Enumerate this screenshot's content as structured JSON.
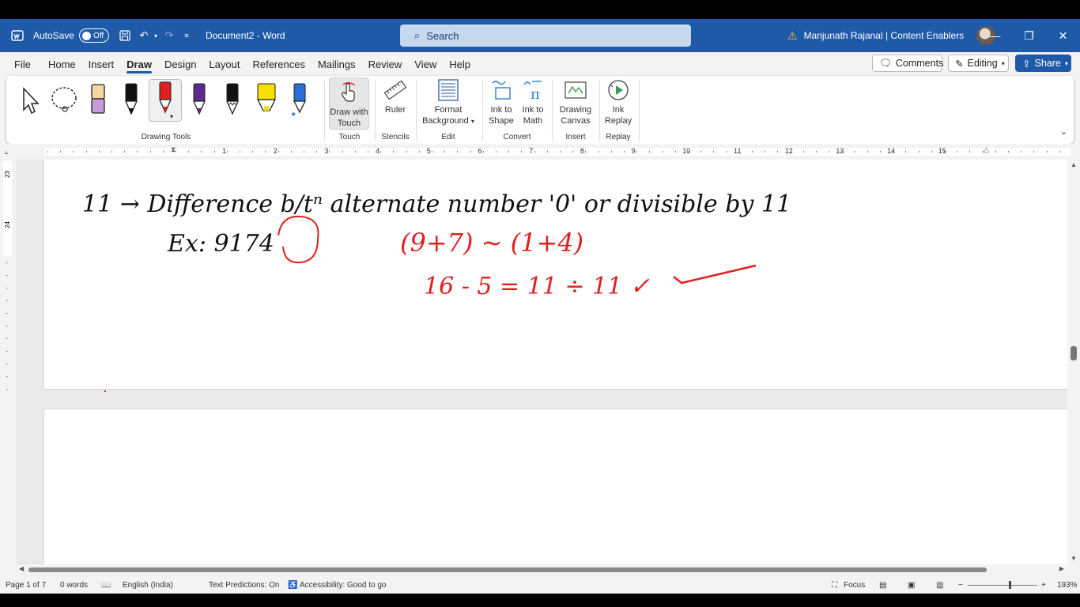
{
  "titlebar": {
    "autosave_label": "AutoSave",
    "autosave_state": "Off",
    "doc_title": "Document2  -  Word",
    "search_placeholder": "Search",
    "user_name": "Manjunath Rajanal | Content Enablers"
  },
  "menu": {
    "tabs": [
      "File",
      "Home",
      "Insert",
      "Draw",
      "Design",
      "Layout",
      "References",
      "Mailings",
      "Review",
      "View",
      "Help"
    ],
    "active": "Draw",
    "comments_label": "Comments",
    "editing_label": "Editing",
    "share_label": "Share"
  },
  "ribbon": {
    "groups": {
      "drawing_tools": "Drawing Tools",
      "touch": "Touch",
      "stencils": "Stencils",
      "edit": "Edit",
      "convert": "Convert",
      "insert": "Insert",
      "replay": "Replay"
    },
    "buttons": {
      "draw_with_touch_1": "Draw with",
      "draw_with_touch_2": "Touch",
      "ruler": "Ruler",
      "format_bg_1": "Format",
      "format_bg_2": "Background",
      "ink_shape_1": "Ink to",
      "ink_shape_2": "Shape",
      "ink_math_1": "Ink to",
      "ink_math_2": "Math",
      "drawing_canvas_1": "Drawing",
      "drawing_canvas_2": "Canvas",
      "ink_replay_1": "Ink",
      "ink_replay_2": "Replay"
    },
    "pen_colors": [
      "#111111",
      "#e02020",
      "#5b2a91",
      "#111111",
      "#f5e000",
      "#2a6fd6"
    ]
  },
  "ruler": {
    "numbers": [
      "1",
      "2",
      "3",
      "4",
      "5",
      "6",
      "7",
      "8",
      "9",
      "10",
      "11",
      "12",
      "13",
      "14",
      "15"
    ]
  },
  "vruler": {
    "labels": [
      "23",
      "24"
    ]
  },
  "ink": {
    "line1": "11 → Difference b/tⁿ alternate number '0' or divisible by 11",
    "line2": "Ex: 9174",
    "line3": "(9+7) ~ (1+4)",
    "line4": "16 - 5 = 11 ÷ 11 ✓"
  },
  "status": {
    "page": "Page 1 of 7",
    "words": "0 words",
    "language": "English (India)",
    "predictions": "Text Predictions: On",
    "accessibility": "Accessibility: Good to go",
    "focus": "Focus",
    "zoom": "193%"
  },
  "colors": {
    "titlebar": "#1e5aa8",
    "ink_black": "#111111",
    "ink_red": "#e02020"
  }
}
